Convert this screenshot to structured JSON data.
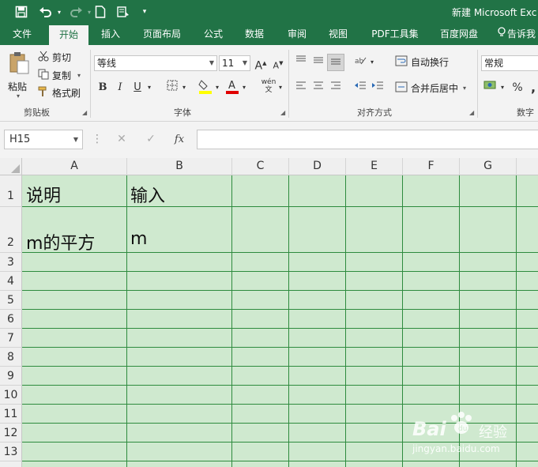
{
  "window": {
    "title": "新建 Microsoft Exc"
  },
  "icons": [
    "save-icon",
    "undo-icon",
    "redo-icon",
    "new-file-icon",
    "touch-mode-icon",
    "customize-qat-icon"
  ],
  "tabs": [
    {
      "label": "文件"
    },
    {
      "label": "开始"
    },
    {
      "label": "插入"
    },
    {
      "label": "页面布局"
    },
    {
      "label": "公式"
    },
    {
      "label": "数据"
    },
    {
      "label": "审阅"
    },
    {
      "label": "视图"
    },
    {
      "label": "PDF工具集"
    },
    {
      "label": "百度网盘"
    },
    {
      "label": "告诉我"
    }
  ],
  "ribbon": {
    "clipboard": {
      "paste_label": "粘贴",
      "cut_label": "剪切",
      "copy_label": "复制",
      "format_painter_label": "格式刷",
      "group_label": "剪贴板"
    },
    "font": {
      "font_name": "等线",
      "font_size": "11",
      "grow_label": "A",
      "shrink_label": "A",
      "bold": "B",
      "italic": "I",
      "underline": "U",
      "phonetic_label": "wén",
      "group_label": "字体"
    },
    "alignment": {
      "wrap_text_label": "自动换行",
      "merge_center_label": "合并后居中",
      "group_label": "对齐方式"
    },
    "number": {
      "format": "常规",
      "percent": "%",
      "comma": ",",
      "group_label": "数字"
    }
  },
  "formula_bar": {
    "name_box": "H15",
    "cancel": "✕",
    "enter": "✓",
    "fx": "fx",
    "content": ""
  },
  "sheet": {
    "columns": [
      "A",
      "B",
      "C",
      "D",
      "E",
      "F",
      "G"
    ],
    "rows": [
      "1",
      "2",
      "3",
      "4",
      "5",
      "6",
      "7",
      "8",
      "9",
      "10",
      "11",
      "12",
      "13"
    ],
    "cells": {
      "A1": "说明",
      "B1": "输入",
      "A2": "m的平方",
      "B2": "m"
    },
    "grid_color": "#2e8b3e",
    "fill_color": "#cfe9cf"
  },
  "watermark": {
    "brand": "Bai",
    "brand_cn": "经验",
    "url": "jingyan.baidu.com"
  },
  "colors": {
    "accent": "#217346",
    "font_highlight": "#ffff00",
    "font_color": "#e00000"
  }
}
